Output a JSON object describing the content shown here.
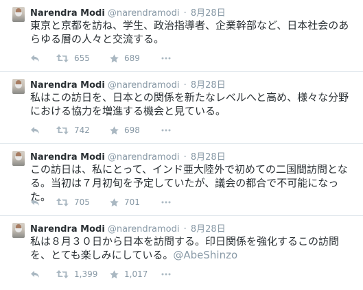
{
  "tweets": [
    {
      "name": "Narendra Modi",
      "handle": "@narendramodi",
      "date": "8月28日",
      "text": "東京と京都を訪ね、学生、政治指導者、企業幹部など、日本社会のあらゆる層の人々と交流する。",
      "mention": "",
      "retweets": "655",
      "favorites": "689"
    },
    {
      "name": "Narendra Modi",
      "handle": "@narendramodi",
      "date": "8月28日",
      "text": "私はこの訪日を、日本との関係を新たなレベルへと高め、様々な分野における協力を増進する機会と見ている。",
      "mention": "",
      "retweets": "742",
      "favorites": "698"
    },
    {
      "name": "Narendra Modi",
      "handle": "@narendramodi",
      "date": "8月28日",
      "text": "この訪日は、私にとって、インド亜大陸外で初めての二国間訪問となる。当初は７月初旬を予定していたが、議会の都合で不可能になった。",
      "mention": "",
      "retweets": "705",
      "favorites": "701"
    },
    {
      "name": "Narendra Modi",
      "handle": "@narendramodi",
      "date": "8月28日",
      "text": "私は８月３０日から日本を訪問する。印日関係を強化するこの訪問を、とても楽しみにしている。",
      "mention": "@AbeShinzo",
      "retweets": "1,399",
      "favorites": "1,017"
    }
  ],
  "separator": "·",
  "icons": [
    "reply-icon",
    "retweet-icon",
    "favorite-icon",
    "more-icon"
  ],
  "colors": {
    "name": "#292f33",
    "meta": "#8899a6",
    "icon": "#aab8c2",
    "divider": "#e1e8ed"
  }
}
